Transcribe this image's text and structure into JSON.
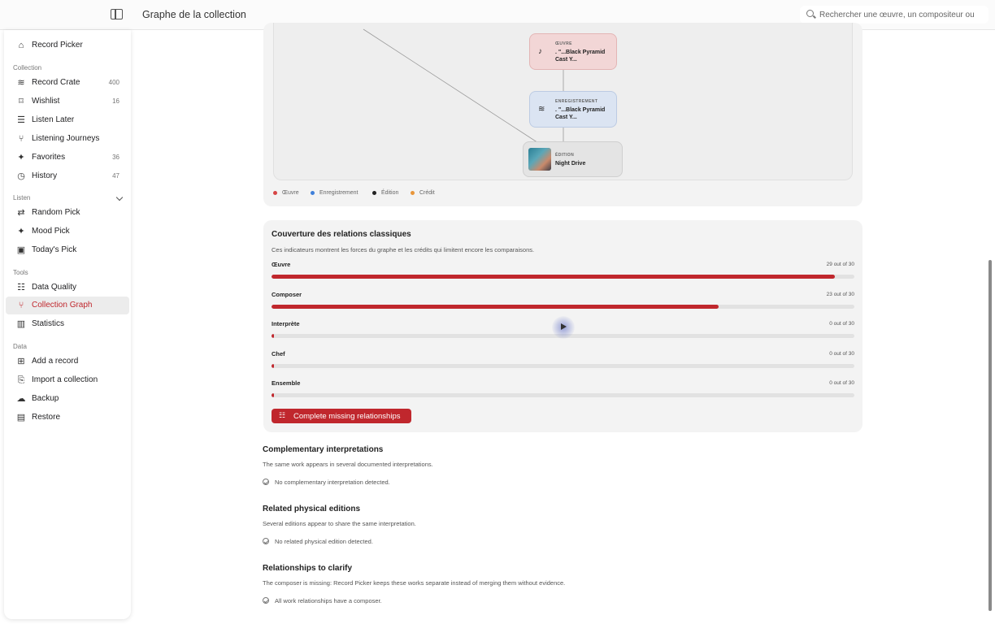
{
  "header": {
    "title": "Graphe de la collection",
    "search_placeholder": "Rechercher une œuvre, un compositeur ou"
  },
  "sidebar": {
    "app": {
      "label": "Record Picker",
      "icon": "home-icon"
    },
    "sections": {
      "collection": "Collection",
      "listen": "Listen",
      "tools": "Tools",
      "data": "Data"
    },
    "collection_items": [
      {
        "label": "Record Crate",
        "count": "400",
        "icon": "stack-icon"
      },
      {
        "label": "Wishlist",
        "count": "16",
        "icon": "bookmark-icon"
      },
      {
        "label": "Listen Later",
        "count": "",
        "icon": "list-icon"
      },
      {
        "label": "Listening Journeys",
        "count": "",
        "icon": "branch-icon"
      },
      {
        "label": "Favorites",
        "count": "36",
        "icon": "sparkle-icon"
      },
      {
        "label": "History",
        "count": "47",
        "icon": "clock-icon"
      }
    ],
    "listen_items": [
      {
        "label": "Random Pick",
        "icon": "shuffle-icon"
      },
      {
        "label": "Mood Pick",
        "icon": "sparkle-icon"
      },
      {
        "label": "Today's Pick",
        "icon": "calendar-icon"
      }
    ],
    "tools_items": [
      {
        "label": "Data Quality",
        "icon": "checklist-icon"
      },
      {
        "label": "Collection Graph",
        "icon": "graph-icon",
        "active": true
      },
      {
        "label": "Statistics",
        "icon": "bar-chart-icon"
      }
    ],
    "data_items": [
      {
        "label": "Add a record",
        "icon": "add-record-icon"
      },
      {
        "label": "Import a collection",
        "icon": "import-icon"
      },
      {
        "label": "Backup",
        "icon": "cloud-icon"
      },
      {
        "label": "Restore",
        "icon": "archive-icon"
      }
    ]
  },
  "graph": {
    "nodes": {
      "oeuvre": {
        "kind": "ŒUVRE",
        "name": ". \"...Black Pyramid Cast Y..."
      },
      "enregistrement": {
        "kind": "ENREGISTREMENT",
        "name": ". \"...Black Pyramid Cast Y..."
      },
      "edition": {
        "kind": "ÉDITION",
        "name": "Night Drive"
      }
    },
    "legend": [
      {
        "label": "Œuvre",
        "color": "#d64545"
      },
      {
        "label": "Enregistrement",
        "color": "#3f7fd9"
      },
      {
        "label": "Édition",
        "color": "#222222"
      },
      {
        "label": "Crédit",
        "color": "#e8963a"
      }
    ]
  },
  "coverage": {
    "title": "Couverture des relations classiques",
    "subtitle": "Ces indicateurs montrent les forces du graphe et les crédits qui limitent encore les comparaisons.",
    "metrics": [
      {
        "label": "Œuvre",
        "value_text": "29 out of 30",
        "value": 29,
        "total": 30
      },
      {
        "label": "Composer",
        "value_text": "23 out of 30",
        "value": 23,
        "total": 30
      },
      {
        "label": "Interprète",
        "value_text": "0 out of 30",
        "value": 0,
        "total": 30
      },
      {
        "label": "Chef",
        "value_text": "0 out of 30",
        "value": 0,
        "total": 30
      },
      {
        "label": "Ensemble",
        "value_text": "0 out of 30",
        "value": 0,
        "total": 30
      }
    ],
    "cta_label": "Complete missing relationships",
    "accent": "#c0272d"
  },
  "sections": [
    {
      "title": "Complementary interpretations",
      "description": "The same work appears in several documented interpretations.",
      "status": "No complementary interpretation detected."
    },
    {
      "title": "Related physical editions",
      "description": "Several editions appear to share the same interpretation.",
      "status": "No related physical edition detected."
    },
    {
      "title": "Relationships to clarify",
      "description": "The composer is missing: Record Picker keeps these works separate instead of merging them without evidence.",
      "status": "All work relationships have a composer."
    }
  ]
}
